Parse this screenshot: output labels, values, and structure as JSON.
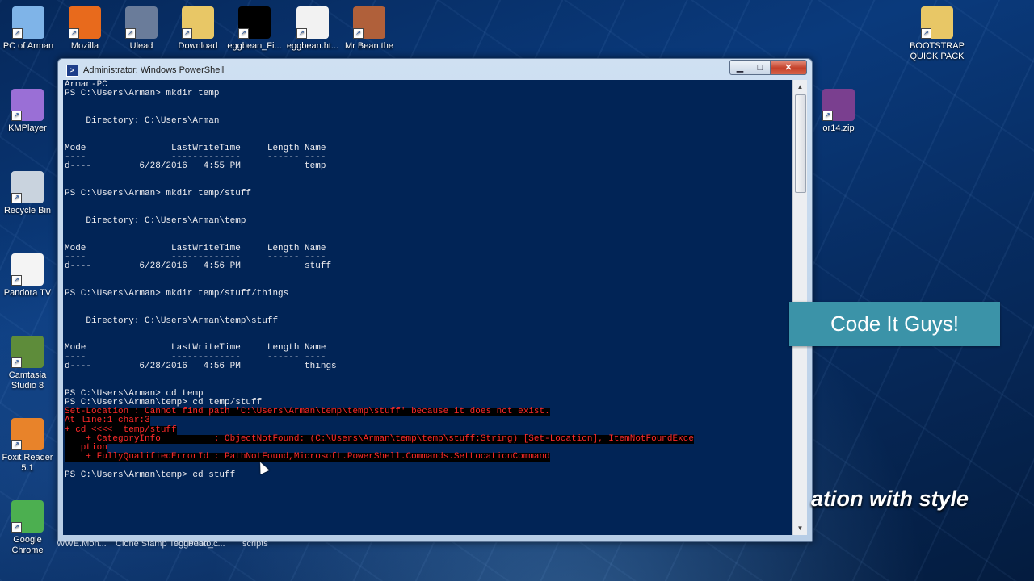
{
  "desktop": {
    "top_icons": [
      {
        "label": "PC of Arman",
        "icon": "computer-icon",
        "color": "#7fb4e8"
      },
      {
        "label": "Mozilla",
        "icon": "firefox-icon",
        "color": "#e86a1c"
      },
      {
        "label": "Ulead",
        "icon": "ulead-icon",
        "color": "#6a7c9a"
      },
      {
        "label": "Download",
        "icon": "folder-icon",
        "color": "#e8c766"
      },
      {
        "label": "eggbean_Fi...",
        "icon": "file-black-icon",
        "color": "#000000"
      },
      {
        "label": "eggbean.ht...",
        "icon": "firefox-html-icon",
        "color": "#f2f2f2"
      },
      {
        "label": "Mr Bean the",
        "icon": "video-thumbnail-icon",
        "color": "#b0603a"
      }
    ],
    "left_icons": [
      {
        "label": "KMPlayer",
        "icon": "kmplayer-icon",
        "color": "#9a6fd6"
      },
      {
        "label": "Recycle Bin",
        "icon": "recycle-bin-icon",
        "color": "#c9d3de"
      },
      {
        "label": "Pandora TV",
        "icon": "document-icon",
        "color": "#f4f4f4"
      },
      {
        "label": "Camtasia Studio 8",
        "icon": "camtasia-icon",
        "color": "#5e8c3a"
      },
      {
        "label": "Foxit Reader 5.1",
        "icon": "foxit-icon",
        "color": "#e8832a"
      },
      {
        "label": "Google Chrome",
        "icon": "chrome-icon",
        "color": "#4caf50"
      }
    ],
    "right_icons": [
      {
        "label": "BOOTSTRAP QUICK PACK",
        "icon": "folder-icon",
        "color": "#e8c766"
      },
      {
        "label": "or14.zip",
        "icon": "winrar-icon",
        "color": "#7a3f8f"
      }
    ],
    "bottom_labels": [
      "WWE.Mon...",
      "Clone Stamp Tool Photo...",
      "eggbean_c...",
      "scripts"
    ]
  },
  "window": {
    "title": "Administrator: Windows PowerShell",
    "minimize": "▁",
    "maximize": "□",
    "close": "✕"
  },
  "console_lines": [
    {
      "text": "Arman-PC",
      "error": false
    },
    {
      "text": "PS C:\\Users\\Arman> mkdir temp",
      "error": false
    },
    {
      "text": "",
      "error": false
    },
    {
      "text": "",
      "error": false
    },
    {
      "text": "    Directory: C:\\Users\\Arman",
      "error": false
    },
    {
      "text": "",
      "error": false
    },
    {
      "text": "",
      "error": false
    },
    {
      "text": "Mode                LastWriteTime     Length Name",
      "error": false
    },
    {
      "text": "----                -------------     ------ ----",
      "error": false
    },
    {
      "text": "d----         6/28/2016   4:55 PM            temp",
      "error": false
    },
    {
      "text": "",
      "error": false
    },
    {
      "text": "",
      "error": false
    },
    {
      "text": "PS C:\\Users\\Arman> mkdir temp/stuff",
      "error": false
    },
    {
      "text": "",
      "error": false
    },
    {
      "text": "",
      "error": false
    },
    {
      "text": "    Directory: C:\\Users\\Arman\\temp",
      "error": false
    },
    {
      "text": "",
      "error": false
    },
    {
      "text": "",
      "error": false
    },
    {
      "text": "Mode                LastWriteTime     Length Name",
      "error": false
    },
    {
      "text": "----                -------------     ------ ----",
      "error": false
    },
    {
      "text": "d----         6/28/2016   4:56 PM            stuff",
      "error": false
    },
    {
      "text": "",
      "error": false
    },
    {
      "text": "",
      "error": false
    },
    {
      "text": "PS C:\\Users\\Arman> mkdir temp/stuff/things",
      "error": false
    },
    {
      "text": "",
      "error": false
    },
    {
      "text": "",
      "error": false
    },
    {
      "text": "    Directory: C:\\Users\\Arman\\temp\\stuff",
      "error": false
    },
    {
      "text": "",
      "error": false
    },
    {
      "text": "",
      "error": false
    },
    {
      "text": "Mode                LastWriteTime     Length Name",
      "error": false
    },
    {
      "text": "----                -------------     ------ ----",
      "error": false
    },
    {
      "text": "d----         6/28/2016   4:56 PM            things",
      "error": false
    },
    {
      "text": "",
      "error": false
    },
    {
      "text": "",
      "error": false
    },
    {
      "text": "PS C:\\Users\\Arman> cd temp",
      "error": false
    },
    {
      "text": "PS C:\\Users\\Arman\\temp> cd temp/stuff",
      "error": false
    },
    {
      "text": "Set-Location : Cannot find path 'C:\\Users\\Arman\\temp\\temp\\stuff' because it does not exist.",
      "error": true
    },
    {
      "text": "At line:1 char:3",
      "error": true
    },
    {
      "text": "+ cd <<<<  temp/stuff",
      "error": true
    },
    {
      "text": "    + CategoryInfo          : ObjectNotFound: (C:\\Users\\Arman\\temp\\temp\\stuff:String) [Set-Location], ItemNotFoundExce",
      "error": true
    },
    {
      "text": "   ption",
      "error": true
    },
    {
      "text": "    + FullyQualifiedErrorId : PathNotFound,Microsoft.PowerShell.Commands.SetLocationCommand",
      "error": true
    },
    {
      "text": "",
      "error": false
    },
    {
      "text": "PS C:\\Users\\Arman\\temp> cd stuff",
      "error": false
    }
  ],
  "overlay": {
    "banner": "Code It Guys!",
    "tagline": "ation with style",
    "banner_color": "#3b93a8"
  }
}
